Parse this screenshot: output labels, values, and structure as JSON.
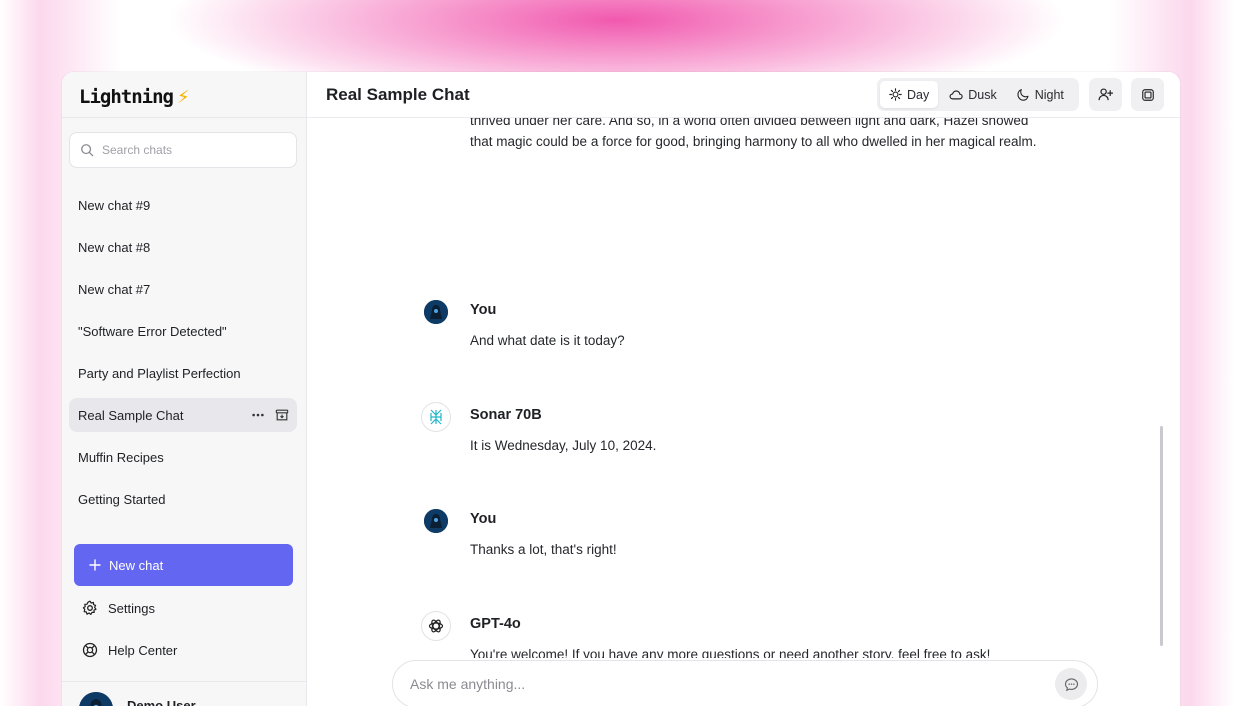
{
  "brand": {
    "name": "Lightning",
    "emoji": "⚡"
  },
  "search": {
    "placeholder": "Search chats"
  },
  "chats": [
    {
      "label": "New chat #9"
    },
    {
      "label": "New chat #8"
    },
    {
      "label": "New chat #7"
    },
    {
      "label": "\"Software Error Detected\""
    },
    {
      "label": "Party and Playlist Perfection"
    },
    {
      "label": "Real Sample Chat"
    },
    {
      "label": "Muffin Recipes"
    },
    {
      "label": "Getting Started"
    }
  ],
  "sidebar": {
    "new_chat": "New chat",
    "settings": "Settings",
    "help": "Help Center",
    "user_name": "Demo User"
  },
  "header": {
    "title": "Real Sample Chat",
    "themes": [
      "Day",
      "Dusk",
      "Night"
    ],
    "active_theme": "Day"
  },
  "messages": [
    {
      "author": "",
      "text": "thrived under her care. And so, in a world often divided between light and dark, Hazel showed that magic could be a force for good, bringing harmony to all who dwelled in her magical realm."
    },
    {
      "author": "You",
      "text": "And what date is it today?"
    },
    {
      "author": "Sonar 70B",
      "text": "It is Wednesday, July 10, 2024."
    },
    {
      "author": "You",
      "text": "Thanks a lot, that's right!"
    },
    {
      "author": "GPT-4o",
      "text": "You're welcome! If you have any more questions or need another story, feel free to ask!"
    }
  ],
  "composer": {
    "placeholder": "Ask me anything..."
  },
  "colors": {
    "accent": "#6366f1",
    "glow": "#f050aa"
  }
}
